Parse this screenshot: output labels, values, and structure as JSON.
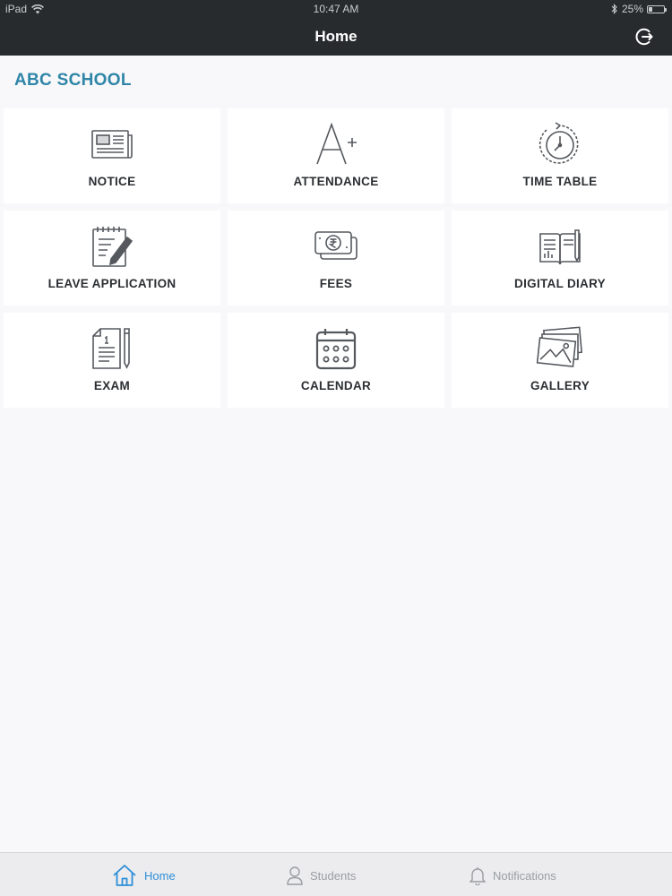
{
  "status_bar": {
    "device": "iPad",
    "time": "10:47 AM",
    "battery": "25%",
    "battery_level": 0.25
  },
  "nav": {
    "title": "Home",
    "logout_icon": "logout-icon"
  },
  "school_name": "ABC SCHOOL",
  "tiles": [
    {
      "label": "NOTICE",
      "icon": "newspaper-icon"
    },
    {
      "label": "ATTENDANCE",
      "icon": "grade-a-plus-icon"
    },
    {
      "label": "TIME TABLE",
      "icon": "clock-icon"
    },
    {
      "label": "LEAVE APPLICATION",
      "icon": "notepad-pencil-icon"
    },
    {
      "label": "FEES",
      "icon": "rupee-notes-icon"
    },
    {
      "label": "DIGITAL DIARY",
      "icon": "diary-icon"
    },
    {
      "label": "EXAM",
      "icon": "exam-paper-icon"
    },
    {
      "label": "CALENDAR",
      "icon": "calendar-icon"
    },
    {
      "label": "GALLERY",
      "icon": "gallery-icon"
    }
  ],
  "tabbar": {
    "items": [
      {
        "label": "Home",
        "icon": "home-icon",
        "active": true
      },
      {
        "label": "Students",
        "icon": "user-icon",
        "active": false
      },
      {
        "label": "Notifications",
        "icon": "bell-icon",
        "active": false
      }
    ]
  },
  "colors": {
    "bar_dark": "#282b2e",
    "accent_teal": "#2f86a8",
    "active_tab": "#2d8fd8",
    "icon_gray": "#55595e"
  }
}
